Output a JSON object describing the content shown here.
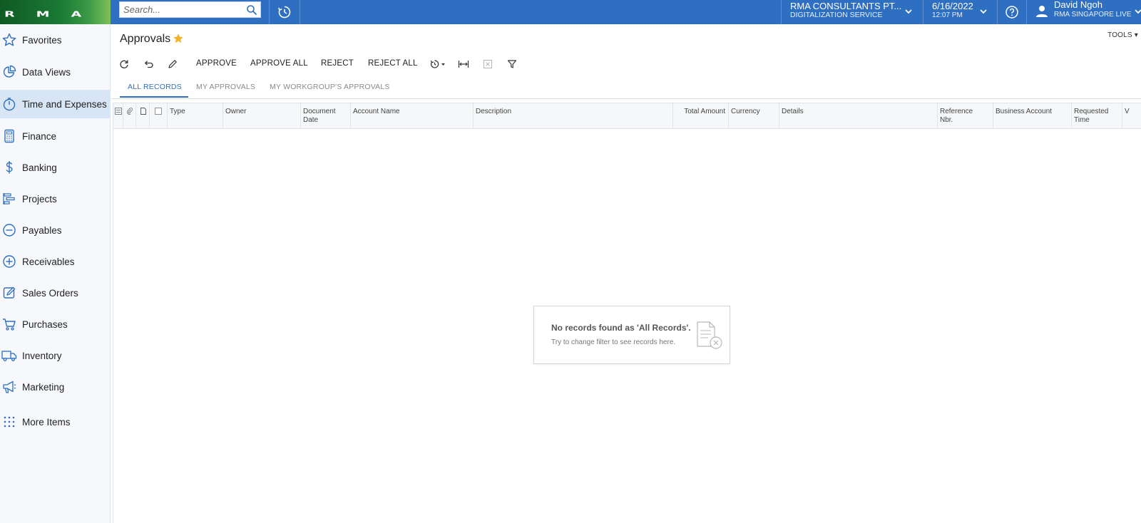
{
  "app": {
    "logo_text": "RMA",
    "search_placeholder": "Search...",
    "company": {
      "name": "RMA CONSULTANTS PT...",
      "branch": "DIGITALIZATION SERVICE"
    },
    "datetime": {
      "date": "6/16/2022",
      "time": "12:07 PM"
    },
    "user": {
      "name": "David Ngoh",
      "tenant": "RMA SINGAPORE LIVE"
    },
    "colors": {
      "topbar": "#2f6fc2",
      "logo": "#1b7a35",
      "accent": "#2f6fc2",
      "star": "#f0b429",
      "sidebar_active": "#d8e5f4"
    }
  },
  "sidebar": {
    "items": [
      {
        "label": "Favorites",
        "icon": "star-icon"
      },
      {
        "label": "Data Views",
        "icon": "pie-chart-icon"
      },
      {
        "label": "Time and Expenses",
        "icon": "clock-icon",
        "active": true
      },
      {
        "label": "Finance",
        "icon": "calculator-icon"
      },
      {
        "label": "Banking",
        "icon": "dollar-icon"
      },
      {
        "label": "Projects",
        "icon": "gantt-icon"
      },
      {
        "label": "Payables",
        "icon": "minus-circle-icon"
      },
      {
        "label": "Receivables",
        "icon": "plus-circle-icon"
      },
      {
        "label": "Sales Orders",
        "icon": "edit-icon"
      },
      {
        "label": "Purchases",
        "icon": "cart-icon"
      },
      {
        "label": "Inventory",
        "icon": "truck-icon"
      },
      {
        "label": "Marketing",
        "icon": "megaphone-icon"
      },
      {
        "label": "More Items",
        "icon": "grid-dots-icon"
      }
    ]
  },
  "page": {
    "title": "Approvals",
    "tools_label": "TOOLS",
    "toolbar": {
      "approve": "APPROVE",
      "approve_all": "APPROVE ALL",
      "reject": "REJECT",
      "reject_all": "REJECT ALL"
    },
    "tabs": [
      {
        "label": "ALL RECORDS",
        "active": true
      },
      {
        "label": "MY APPROVALS"
      },
      {
        "label": "MY WORKGROUP'S APPROVALS"
      }
    ],
    "columns": {
      "type": "Type",
      "owner": "Owner",
      "document_date": "Document Date",
      "account_name": "Account Name",
      "description": "Description",
      "total_amount": "Total Amount",
      "currency": "Currency",
      "details": "Details",
      "reference_nbr": "Reference Nbr.",
      "business_account": "Business Account",
      "requested_time": "Requested Time",
      "overflow": "V"
    },
    "empty_state": {
      "title": "No records found as 'All Records'.",
      "hint": "Try to change filter to see records here."
    }
  }
}
